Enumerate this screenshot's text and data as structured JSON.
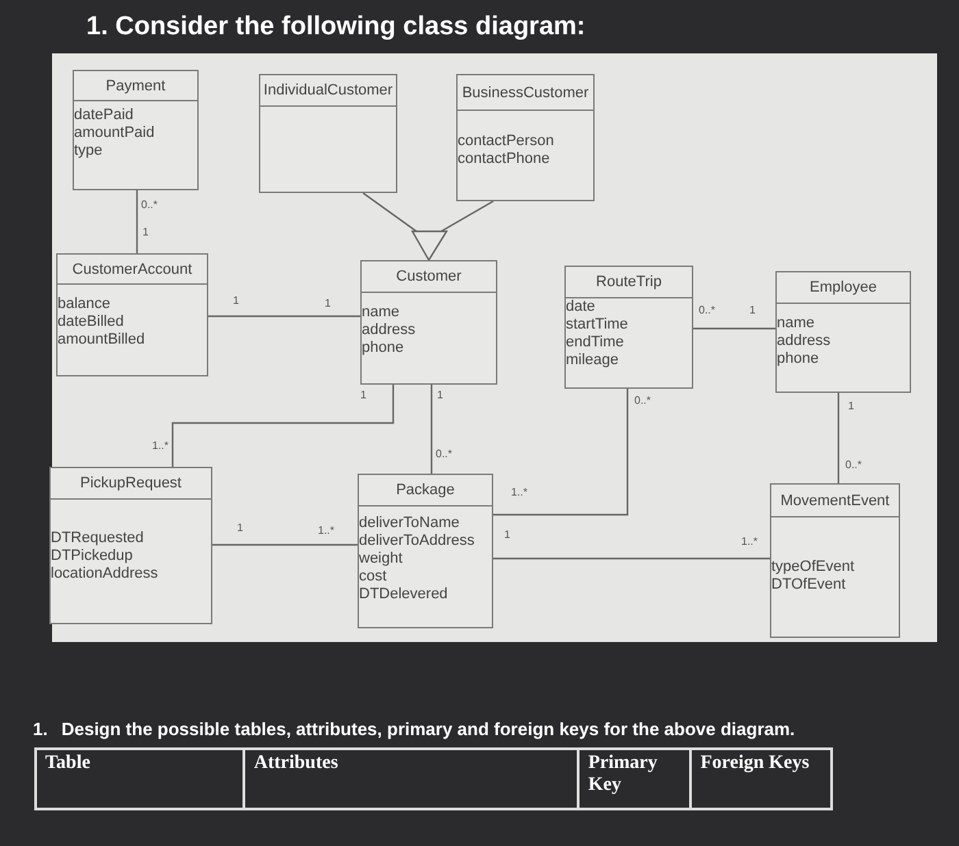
{
  "heading": "1. Consider the following class diagram:",
  "diagram": {
    "classes": [
      {
        "name": "Payment",
        "attributes": [
          "datePaid",
          "amountPaid",
          "type"
        ]
      },
      {
        "name": "IndividualCustomer"
      },
      {
        "name": "BusinessCustomer",
        "attributes": [
          "contactPerson",
          "contactPhone"
        ]
      },
      {
        "name": "CustomerAccount",
        "attributes": [
          "balance",
          "dateBilled",
          "amountBilled"
        ]
      },
      {
        "name": "Customer",
        "attributes": [
          "name",
          "address",
          "phone"
        ]
      },
      {
        "name": "RouteTrip",
        "attributes": [
          "date",
          "startTime",
          "endTime",
          "mileage"
        ]
      },
      {
        "name": "Employee",
        "attributes": [
          "name",
          "address",
          "phone"
        ]
      },
      {
        "name": "PickupRequest",
        "attributes": [
          "DTRequested",
          "DTPickedup",
          "locationAddress"
        ]
      },
      {
        "name": "Package",
        "attributes": [
          "deliverToName",
          "deliverToAddress",
          "weight",
          "cost",
          "DTDelevered"
        ]
      },
      {
        "name": "MovementEvent",
        "attributes": [
          "typeOfEvent",
          "DTOfEvent"
        ]
      }
    ],
    "associations": [
      {
        "ends": [
          "0..*",
          "1"
        ]
      },
      {
        "ends": [
          "1",
          "1"
        ]
      },
      {
        "ends": [
          "0..*",
          "1"
        ]
      },
      {
        "ends": [
          "1",
          "1..*"
        ]
      },
      {
        "ends": [
          "1",
          "0..*"
        ]
      },
      {
        "ends": [
          "1..*",
          "0..*"
        ]
      },
      {
        "ends": [
          "1",
          "0..*"
        ]
      },
      {
        "ends": [
          "1",
          "1..*"
        ]
      },
      {
        "ends": [
          "1",
          "1..*"
        ]
      }
    ]
  },
  "question": {
    "number": "1.",
    "text": "Design the possible tables, attributes, primary and foreign keys for the above diagram."
  },
  "table": {
    "columns": [
      "Table",
      "Attributes",
      "Primary Key",
      "Foreign Keys"
    ]
  }
}
